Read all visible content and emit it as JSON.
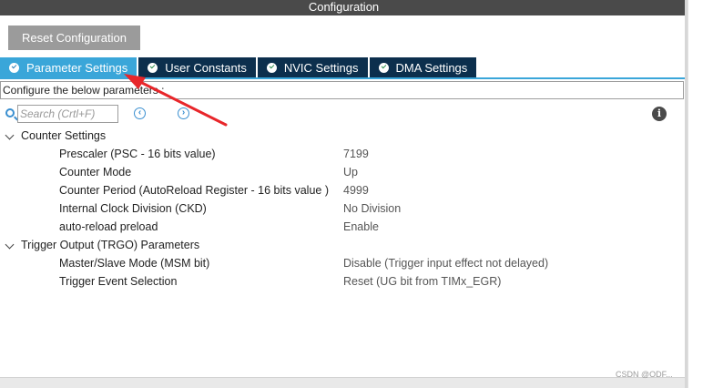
{
  "window": {
    "title": "Configuration"
  },
  "toolbar": {
    "reset_label": "Reset Configuration"
  },
  "tabs": [
    {
      "label": "Parameter Settings",
      "active": true
    },
    {
      "label": "User Constants",
      "active": false
    },
    {
      "label": "NVIC Settings",
      "active": false
    },
    {
      "label": "DMA Settings",
      "active": false
    }
  ],
  "description": "Configure the below parameters :",
  "search": {
    "placeholder": "Search (Crtl+F)"
  },
  "icons": {
    "search": "search-icon",
    "prev": "chevron-left-circle-icon",
    "next": "chevron-right-circle-icon",
    "info": "info-icon",
    "check": "check-circle-icon",
    "expand": "chevron-down-icon"
  },
  "groups": [
    {
      "title": "Counter Settings",
      "params": [
        {
          "name": "Prescaler (PSC - 16 bits value)",
          "value": "7199"
        },
        {
          "name": "Counter Mode",
          "value": "Up"
        },
        {
          "name": "Counter Period (AutoReload Register - 16 bits value )",
          "value": "4999"
        },
        {
          "name": "Internal Clock Division (CKD)",
          "value": "No Division"
        },
        {
          "name": "auto-reload preload",
          "value": "Enable"
        }
      ]
    },
    {
      "title": "Trigger Output (TRGO) Parameters",
      "params": [
        {
          "name": "Master/Slave Mode (MSM bit)",
          "value": "Disable (Trigger input effect not delayed)"
        },
        {
          "name": "Trigger Event Selection",
          "value": "Reset (UG bit from TIMx_EGR)"
        }
      ]
    }
  ],
  "watermark": "CSDN @ODF...",
  "colors": {
    "titlebar": "#4a4a4a",
    "tab_active": "#3aa6d9",
    "tab_inactive": "#0c2f4d",
    "accent": "#3a8fd0",
    "annotation_arrow": "#e8262a"
  }
}
